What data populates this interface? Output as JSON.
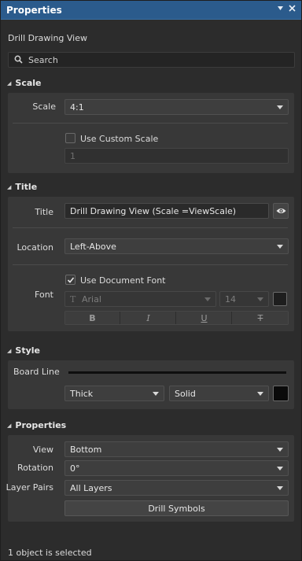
{
  "panel": {
    "title": "Properties",
    "subtitle": "Drill Drawing View",
    "search_placeholder": "Search",
    "status": "1 object is selected"
  },
  "scale": {
    "header": "Scale",
    "scale_label": "Scale",
    "scale_value": "4:1",
    "custom_scale_label": "Use Custom Scale",
    "custom_scale_checked": false,
    "custom_scale_value": "1"
  },
  "title_section": {
    "header": "Title",
    "title_label": "Title",
    "title_value": "Drill Drawing View (Scale =ViewScale)",
    "location_label": "Location",
    "location_value": "Left-Above",
    "font_label": "Font",
    "use_doc_font_label": "Use Document Font",
    "use_doc_font_checked": true,
    "font_name": "Arial",
    "font_size": "14",
    "format_buttons": [
      "B",
      "I",
      "U",
      "T"
    ]
  },
  "style": {
    "header": "Style",
    "board_line_label": "Board Line",
    "weight_value": "Thick",
    "line_style_value": "Solid"
  },
  "properties": {
    "header": "Properties",
    "view_label": "View",
    "view_value": "Bottom",
    "rotation_label": "Rotation",
    "rotation_value": "0°",
    "layer_pairs_label": "Layer Pairs",
    "layer_pairs_value": "All Layers",
    "drill_symbols_button": "Drill Symbols"
  },
  "colors": {
    "titlebar": "#2b5b8c",
    "panel_bg": "#2c2c2c",
    "group_bg": "#383838",
    "swatch": "#111111"
  },
  "icons": [
    "pin-icon",
    "close-icon",
    "search-icon",
    "eye-icon",
    "checkmark-icon",
    "font-type-icon",
    "collapse-triangle-icon"
  ]
}
